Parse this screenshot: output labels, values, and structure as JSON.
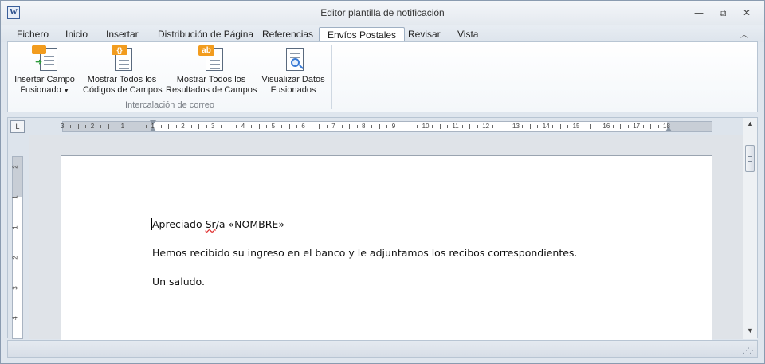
{
  "window": {
    "title": "Editor plantilla de notificación",
    "app_icon": "W",
    "minimize_icon": "minimize-icon",
    "restore_icon": "restore-icon",
    "close_icon": "close-icon"
  },
  "tabs": [
    {
      "label": "Fichero",
      "active": false
    },
    {
      "label": "Inicio",
      "active": false
    },
    {
      "label": "Insertar",
      "active": false
    },
    {
      "label": "Distribución de Página",
      "active": false
    },
    {
      "label": "Referencias",
      "active": false
    },
    {
      "label": "Envíos Postales",
      "active": true
    },
    {
      "label": "Revisar",
      "active": false
    },
    {
      "label": "Vista",
      "active": false
    }
  ],
  "ribbon": {
    "group_label": "Intercalación de correo",
    "buttons": [
      {
        "line1": "Insertar Campo",
        "line2": "Fusionado",
        "icon": "insert-merge-field-icon",
        "has_dropdown": true
      },
      {
        "line1": "Mostrar Todos los",
        "line2": "Códigos de Campos",
        "icon": "show-field-codes-icon",
        "badge": "{}"
      },
      {
        "line1": "Mostrar Todos los",
        "line2": "Resultados de Campos",
        "icon": "show-field-results-icon",
        "badge": "ab"
      },
      {
        "line1": "Visualizar Datos",
        "line2": "Fusionados",
        "icon": "preview-merged-data-icon"
      }
    ]
  },
  "ruler": {
    "tab_selector": "L",
    "h_labels": [
      "3",
      "2",
      "1",
      "1",
      "2",
      "3",
      "4",
      "5",
      "6",
      "7",
      "8",
      "9",
      "10",
      "11",
      "12",
      "13",
      "14",
      "15",
      "16",
      "17",
      "18"
    ],
    "v_labels": [
      "2",
      "1",
      "1",
      "2",
      "3",
      "4"
    ]
  },
  "document": {
    "para1_prefix": "Apreciado ",
    "para1_misspelled": "Sr",
    "para1_suffix": "/a «NOMBRE»",
    "para2": "Hemos recibido su ingreso en el banco y le adjuntamos los recibos correspondientes.",
    "para3": "Un saludo."
  },
  "colors": {
    "accent_orange": "#f29c1e",
    "tab_active_bg": "#ffffff",
    "chrome_bg": "#dfe6ee"
  }
}
